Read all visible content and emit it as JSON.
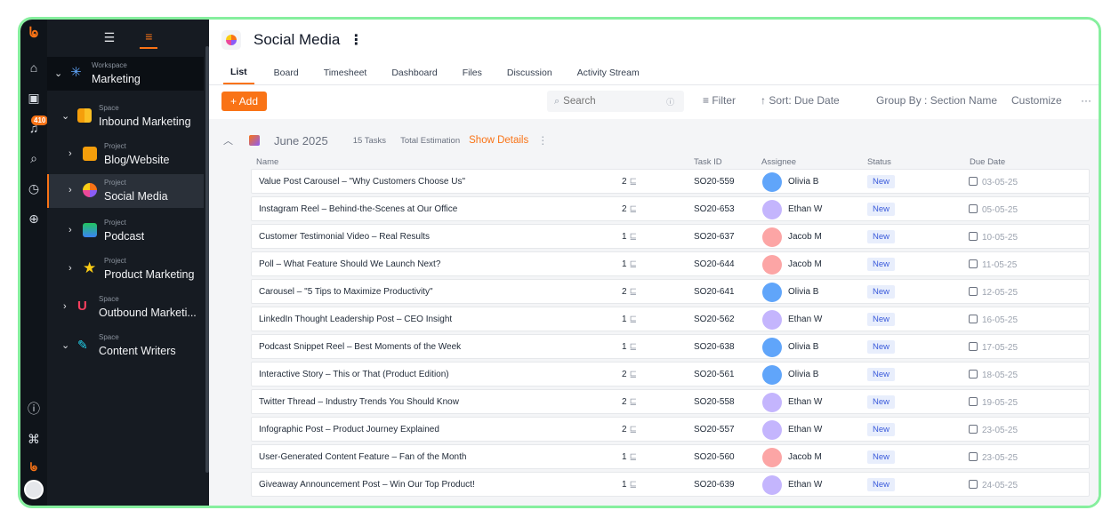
{
  "rail": {
    "badge": "410"
  },
  "sidebar": {
    "items": [
      {
        "kicker": "Workspace",
        "name": "Marketing"
      },
      {
        "kicker": "Space",
        "name": "Inbound Marketing"
      },
      {
        "kicker": "Project",
        "name": "Blog/Website"
      },
      {
        "kicker": "Project",
        "name": "Social Media"
      },
      {
        "kicker": "Project",
        "name": "Podcast"
      },
      {
        "kicker": "Project",
        "name": "Product Marketing"
      },
      {
        "kicker": "Space",
        "name": "Outbound Marketi..."
      },
      {
        "kicker": "Space",
        "name": "Content Writers"
      }
    ]
  },
  "header": {
    "title": "Social Media"
  },
  "tabs": [
    "List",
    "Board",
    "Timesheet",
    "Dashboard",
    "Files",
    "Discussion",
    "Activity Stream"
  ],
  "toolbar": {
    "add_label": "+ Add",
    "search_placeholder": "Search",
    "filter_label": "Filter",
    "sort_label": "Sort: Due Date",
    "group_label": "Group By : Section Name",
    "customize_label": "Customize"
  },
  "section": {
    "title": "June 2025",
    "count": "15 Tasks",
    "total_est": "Total Estimation",
    "show_details": "Show Details"
  },
  "columns": {
    "name": "Name",
    "task_id": "Task ID",
    "assignee": "Assignee",
    "status": "Status",
    "due_date": "Due Date"
  },
  "tasks": [
    {
      "name": "Value Post Carousel – \"Why Customers Choose Us\"",
      "est": "2",
      "id": "SO20-559",
      "assignee": "Olivia B",
      "status": "New",
      "due": "03-05-25"
    },
    {
      "name": "Instagram Reel – Behind-the-Scenes at Our Office",
      "est": "2",
      "id": "SO20-653",
      "assignee": "Ethan W",
      "status": "New",
      "due": "05-05-25"
    },
    {
      "name": "Customer Testimonial Video – Real Results",
      "est": "1",
      "id": "SO20-637",
      "assignee": "Jacob M",
      "status": "New",
      "due": "10-05-25"
    },
    {
      "name": "Poll – What Feature Should We Launch Next?",
      "est": "1",
      "id": "SO20-644",
      "assignee": "Jacob M",
      "status": "New",
      "due": "11-05-25"
    },
    {
      "name": "Carousel – \"5 Tips to Maximize Productivity\"",
      "est": "2",
      "id": "SO20-641",
      "assignee": "Olivia B",
      "status": "New",
      "due": "12-05-25"
    },
    {
      "name": "LinkedIn Thought Leadership Post – CEO Insight",
      "est": "1",
      "id": "SO20-562",
      "assignee": "Ethan W",
      "status": "New",
      "due": "16-05-25"
    },
    {
      "name": "Podcast Snippet Reel – Best Moments of the Week",
      "est": "1",
      "id": "SO20-638",
      "assignee": "Olivia B",
      "status": "New",
      "due": "17-05-25"
    },
    {
      "name": "Interactive Story – This or That (Product Edition)",
      "est": "2",
      "id": "SO20-561",
      "assignee": "Olivia B",
      "status": "New",
      "due": "18-05-25"
    },
    {
      "name": "Twitter Thread – Industry Trends You Should Know",
      "est": "2",
      "id": "SO20-558",
      "assignee": "Ethan W",
      "status": "New",
      "due": "19-05-25"
    },
    {
      "name": "Infographic Post – Product Journey Explained",
      "est": "2",
      "id": "SO20-557",
      "assignee": "Ethan W",
      "status": "New",
      "due": "23-05-25"
    },
    {
      "name": "User-Generated Content Feature – Fan of the Month",
      "est": "1",
      "id": "SO20-560",
      "assignee": "Jacob M",
      "status": "New",
      "due": "23-05-25"
    },
    {
      "name": "Giveaway Announcement Post – Win Our Top Product!",
      "est": "1",
      "id": "SO20-639",
      "assignee": "Ethan W",
      "status": "New",
      "due": "24-05-25"
    }
  ],
  "colors": {
    "accent": "#f97316",
    "frame": "#86ef9e",
    "sidebar_bg": "#161b22",
    "status_bg": "#e8eefc"
  }
}
